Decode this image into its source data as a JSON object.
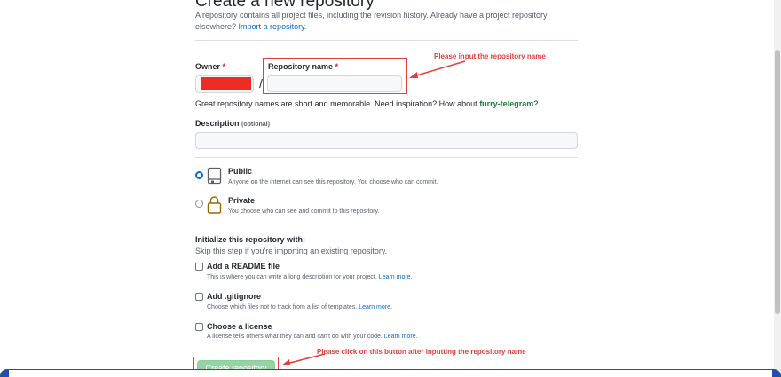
{
  "page": {
    "title": "Create a new repository",
    "intro": "A repository contains all project files, including the revision history. Already have a project repository elsewhere?",
    "import_link": "Import a repository."
  },
  "owner": {
    "label": "Owner",
    "required_mark": "*"
  },
  "separator": "/",
  "repo_name": {
    "label": "Repository name",
    "required_mark": "*",
    "value": ""
  },
  "hint": {
    "text": "Great repository names are short and memorable. Need inspiration? How about",
    "suggestion": "furry-telegram",
    "end": "?"
  },
  "description": {
    "label": "Description",
    "optional": "(optional)",
    "value": ""
  },
  "visibility": {
    "public": {
      "title": "Public",
      "desc": "Anyone on the internet can see this repository. You choose who can commit.",
      "icon": "repo-public-icon"
    },
    "private": {
      "title": "Private",
      "desc": "You choose who can see and commit to this repository.",
      "icon": "lock-icon"
    }
  },
  "init": {
    "heading": "Initialize this repository with:",
    "sub": "Skip this step if you're importing an existing repository.",
    "options": [
      {
        "title": "Add a README file",
        "desc": "This is where you can write a long description for your project.",
        "link": "Learn more."
      },
      {
        "title": "Add .gitignore",
        "desc": "Choose which files not to track from a list of templates.",
        "link": "Learn more."
      },
      {
        "title": "Choose a license",
        "desc": "A license tells others what they can and can't do with your code.",
        "link": "Learn more."
      }
    ]
  },
  "create_button": "Create repository",
  "annotations": {
    "repo_name": "Please input the repository name",
    "create": "Please click on this button after inputting the repository name",
    "color": "#e0403a"
  },
  "colors": {
    "accent": "#0969da",
    "suggestion": "#1a7f37",
    "button": "#94d3a2",
    "required": "#cf222e"
  }
}
